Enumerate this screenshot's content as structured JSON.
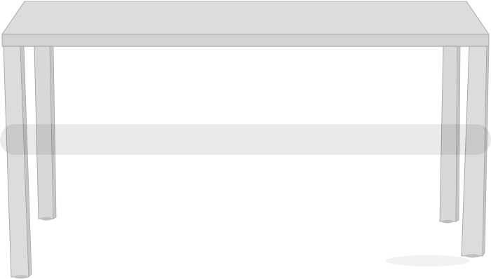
{
  "image": {
    "subject": "table-icon",
    "colors": {
      "background": "#ffffff",
      "top": "#dcdcdc",
      "top_edge": "#cfcfcf",
      "top_underside": "#c9c9c9",
      "leg_front": "#d9d9d9",
      "leg_shadow": "#c6c6c6",
      "leg_highlight": "#e6e6e6",
      "outline": "#a9a9a9",
      "floor_shadow": "#bfbfbf"
    }
  }
}
